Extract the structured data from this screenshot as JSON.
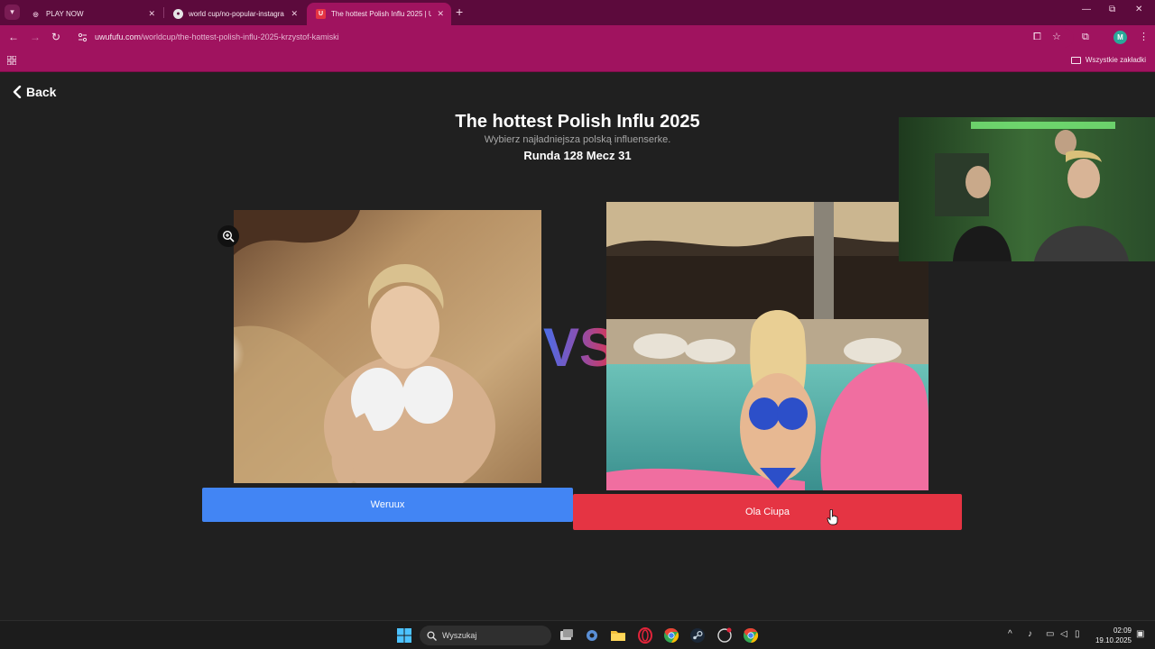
{
  "browser": {
    "tabs": [
      {
        "title": "PLAY NOW",
        "favicon": "headset-icon",
        "active": false
      },
      {
        "title": "world cup/no-popular-instagra",
        "favicon": "chrome-icon",
        "active": false
      },
      {
        "title": "The hottest Polish Influ 2025 | U",
        "favicon": "uwufufu-icon",
        "active": true
      }
    ],
    "url_domain": "uwufufu.com",
    "url_path": "/worldcup/the-hottest-polish-influ-2025-krzystof-kamiski",
    "profile_initial": "M",
    "all_bookmarks_label": "Wszystkie zakładki",
    "accent_color": "#a0135f",
    "frame_color": "#5c0a3c"
  },
  "page": {
    "back_label": "Back",
    "title": "The hottest Polish Influ 2025",
    "subtitle": "Wybierz najładniejsza polską influenserke.",
    "round_label": "Runda 128 Mecz 31",
    "vs_label": "VS",
    "left_choice": {
      "name": "Weruux",
      "color": "#4285f4"
    },
    "right_choice": {
      "name": "Ola Ciupa",
      "color": "#e53443"
    }
  },
  "taskbar": {
    "search_placeholder": "Wyszukaj",
    "time": "02:09",
    "date": "19.10.2025"
  }
}
